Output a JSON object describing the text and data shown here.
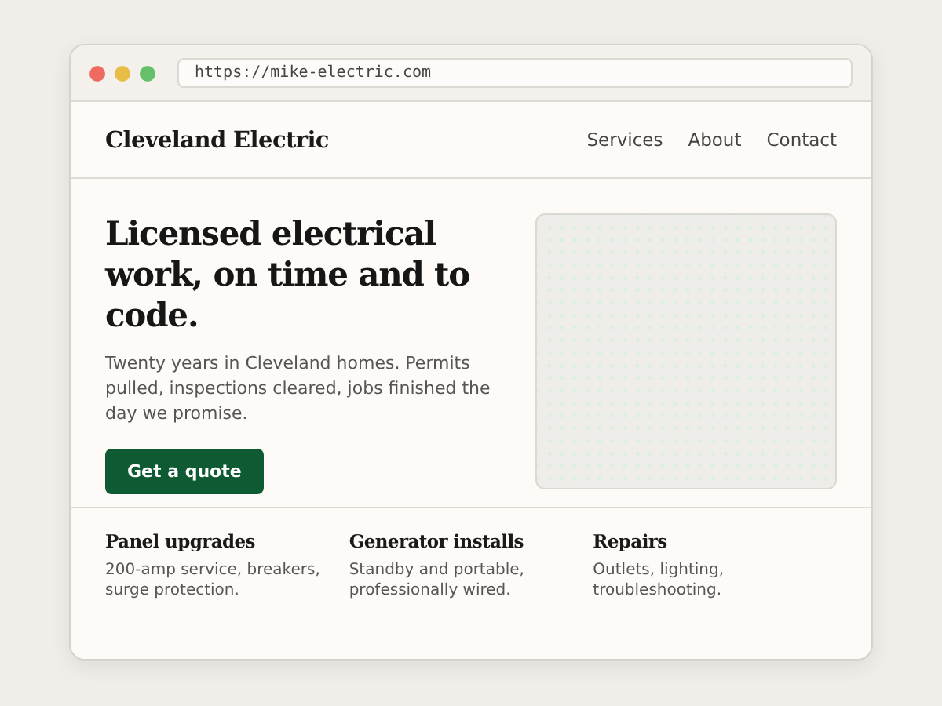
{
  "browser": {
    "url": "https://mike-electric.com"
  },
  "header": {
    "brand": "Cleveland Electric",
    "nav": [
      "Services",
      "About",
      "Contact"
    ]
  },
  "hero": {
    "title": "Licensed electrical work, on time and to code.",
    "text": "Twenty years in Cleveland homes. Permits pulled, inspections cleared, jobs finished the day we promise.",
    "button": "Get a quote"
  },
  "features": [
    {
      "title": "Panel upgrades",
      "text": "200-amp service, breakers, surge protection."
    },
    {
      "title": "Generator installs",
      "text": "Standby and portable, professionally wired."
    },
    {
      "title": "Repairs",
      "text": "Outlets, lighting, troubleshooting."
    }
  ]
}
